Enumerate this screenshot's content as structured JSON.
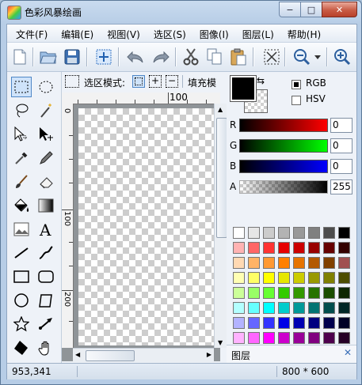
{
  "window": {
    "title": "色彩风暴绘画",
    "minimize": "−",
    "maximize": "□",
    "close": "✕"
  },
  "menu": [
    "文件(F)",
    "编辑(E)",
    "视图(V)",
    "选区(S)",
    "图像(I)",
    "图层(L)",
    "帮助(H)"
  ],
  "toolbar_icons": [
    "new-file-icon",
    "open-folder-icon",
    "save-icon",
    "selection-move-icon",
    "undo-icon",
    "redo-icon",
    "cut-icon",
    "copy-icon",
    "paste-icon",
    "deselect-icon",
    "zoom-out-icon",
    "zoom-dropdown-icon",
    "zoom-in-icon"
  ],
  "tools": [
    "rect-select",
    "ellipse-select",
    "lasso",
    "magic-wand",
    "move-selection",
    "move-pixels",
    "color-picker",
    "pencil",
    "brush",
    "eraser",
    "paint-bucket",
    "gradient",
    "image",
    "text",
    "line",
    "curve",
    "rectangle",
    "rounded-rectangle",
    "ellipse",
    "free-shape",
    "star",
    "arrow",
    "polygon-fill",
    "hand"
  ],
  "selection_bar": {
    "mode_label": "选区模式:",
    "fill_label": "填充模"
  },
  "ruler": {
    "h_label": "100",
    "v_labels": [
      "0",
      "100",
      "200"
    ]
  },
  "color": {
    "models": [
      {
        "label": "RGB",
        "checked": true
      },
      {
        "label": "HSV",
        "checked": false
      }
    ],
    "channels": [
      {
        "label": "R",
        "value": "0",
        "from": "#000000",
        "to": "#ff0000"
      },
      {
        "label": "G",
        "value": "0",
        "from": "#000000",
        "to": "#00ff00"
      },
      {
        "label": "B",
        "value": "0",
        "from": "#000000",
        "to": "#0000ff"
      },
      {
        "label": "A",
        "value": "255",
        "from": "#ffffff",
        "to": "#000000"
      }
    ],
    "palette": [
      [
        "#ffffff",
        "#e6e6e6",
        "#cccccc",
        "#b3b3b3",
        "#999999",
        "#808080",
        "#4d4d4d",
        "#000000"
      ],
      [
        "#ffb3b3",
        "#ff6666",
        "#ff3333",
        "#e60000",
        "#cc0000",
        "#990000",
        "#660000",
        "#330000"
      ],
      [
        "#ffd9b3",
        "#ffb366",
        "#ff9933",
        "#ff8000",
        "#e67300",
        "#b35900",
        "#804000",
        "#a05050"
      ],
      [
        "#ffffb3",
        "#ffff66",
        "#ffff00",
        "#e6e600",
        "#cccc00",
        "#999900",
        "#808000",
        "#4d4d00"
      ],
      [
        "#ccff99",
        "#99ff66",
        "#66ff33",
        "#33cc00",
        "#339900",
        "#267300",
        "#1a4d00",
        "#0d2600"
      ],
      [
        "#b3ffff",
        "#66ffff",
        "#00ffff",
        "#00cccc",
        "#009999",
        "#007373",
        "#004d4d",
        "#002626"
      ],
      [
        "#b3b3ff",
        "#6666ff",
        "#3333ff",
        "#0000e6",
        "#0000b3",
        "#000080",
        "#00004d",
        "#000026"
      ],
      [
        "#ffb3ff",
        "#ff66ff",
        "#ff00ff",
        "#cc00cc",
        "#990099",
        "#800080",
        "#4d004d",
        "#260026"
      ]
    ]
  },
  "layers": {
    "title": "图层",
    "close": "✕"
  },
  "status": {
    "coords": "953,341",
    "size": "800 * 600"
  }
}
